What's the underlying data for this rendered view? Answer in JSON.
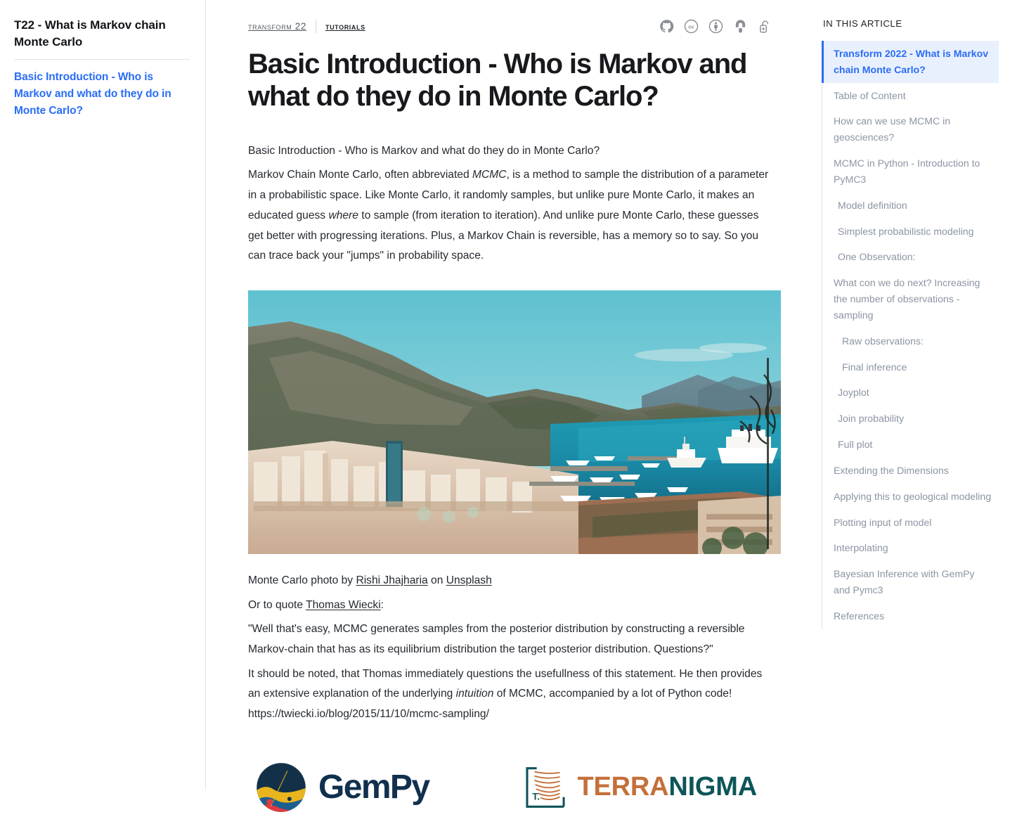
{
  "left_sidebar": {
    "title": "T22 - What is Markov chain Monte Carlo",
    "link": "Basic Introduction - Who is Markov and what do they do in Monte Carlo?"
  },
  "breadcrumb": {
    "parent": "Transform 22",
    "current": "Tutorials"
  },
  "badges": [
    {
      "name": "github-icon",
      "label": "GitHub"
    },
    {
      "name": "creative-commons-icon",
      "label": "Creative Commons"
    },
    {
      "name": "cc-by-icon",
      "label": "CC BY Attribution"
    },
    {
      "name": "open-access-icon",
      "label": "Open Access"
    },
    {
      "name": "open-lock-icon",
      "label": "Open Lock"
    }
  ],
  "article": {
    "title": "Basic Introduction - Who is Markov and what do they do in Monte Carlo?",
    "p1_line1": "Basic Introduction - Who is Markov and what do they do in Monte Carlo?",
    "p1_a": "Markov Chain Monte Carlo, often abbreviated ",
    "p1_em1": "MCMC",
    "p1_b": ", is a method to sample the distribution of a parameter in a probabilistic space. Like Monte Carlo, it randomly samples, but unlike pure Monte Carlo, it makes an educated guess ",
    "p1_em2": "where",
    "p1_c": " to sample (from iteration to iteration). And unlike pure Monte Carlo, these guesses get better with progressing iterations. Plus, a Markov Chain is reversible, has a memory so to say. So you can trace back your \"jumps\" in probability space.",
    "caption_a": "Monte Carlo photo by ",
    "caption_link1": "Rishi Jhajharia",
    "caption_b": " on ",
    "caption_link2": "Unsplash",
    "quote_intro_a": "Or to quote ",
    "quote_link": "Thomas Wiecki",
    "quote_intro_b": ":",
    "quote": "\"Well that's easy, MCMC generates samples from the posterior distribution by constructing a reversible Markov-chain that has as its equilibrium distribution the target posterior distribution. Questions?\"",
    "p_note_a": "It should be noted, that Thomas immediately questions the usefullness of this statement. He then provides an extensive explanation of the underlying ",
    "p_note_em": "intuition",
    "p_note_b": " of MCMC, accompanied by a lot of Python code! https://twiecki.io/blog/2015/11/10/mcmc-sampling/",
    "hero_alt": "Monte Carlo harbour photo"
  },
  "logos": {
    "gempy": "GemPy",
    "terranigma_1": "TERRA",
    "terranigma_2": "NIGMA",
    "terranigma_mark_label": "T."
  },
  "toc": {
    "heading": "IN THIS ARTICLE",
    "items": [
      {
        "label": "Transform 2022 - What is Markov chain Monte Carlo?",
        "level": 1,
        "active": true
      },
      {
        "label": "Table of Content",
        "level": 1,
        "active": false
      },
      {
        "label": "How can we use MCMC in geosciences?",
        "level": 1,
        "active": false
      },
      {
        "label": "MCMC in Python - Introduction to PyMC3",
        "level": 1,
        "active": false
      },
      {
        "label": "Model definition",
        "level": 2,
        "active": false
      },
      {
        "label": "Simplest probabilistic modeling",
        "level": 2,
        "active": false
      },
      {
        "label": "One Observation:",
        "level": 2,
        "active": false
      },
      {
        "label": "What con we do next? Increasing the number of observations - sampling",
        "level": 1,
        "active": false
      },
      {
        "label": "Raw observations:",
        "level": 3,
        "active": false
      },
      {
        "label": "Final inference",
        "level": 3,
        "active": false
      },
      {
        "label": "Joyplot",
        "level": 2,
        "active": false
      },
      {
        "label": "Join probability",
        "level": 2,
        "active": false
      },
      {
        "label": "Full plot",
        "level": 2,
        "active": false
      },
      {
        "label": "Extending the Dimensions",
        "level": 1,
        "active": false
      },
      {
        "label": "Applying this to geological modeling",
        "level": 1,
        "active": false
      },
      {
        "label": "Plotting input of model",
        "level": 1,
        "active": false
      },
      {
        "label": "Interpolating",
        "level": 1,
        "active": false
      },
      {
        "label": "Bayesian Inference with GemPy and Pymc3",
        "level": 1,
        "active": false
      },
      {
        "label": "References",
        "level": 1,
        "active": false
      }
    ]
  },
  "colors": {
    "link_blue": "#2a6df5",
    "toc_active_bg": "#e9f0fd",
    "text": "#24292f",
    "muted": "#8b95a3",
    "gempy_navy": "#11304e",
    "terra_orange": "#c4703a",
    "terra_teal": "#0d5559"
  }
}
